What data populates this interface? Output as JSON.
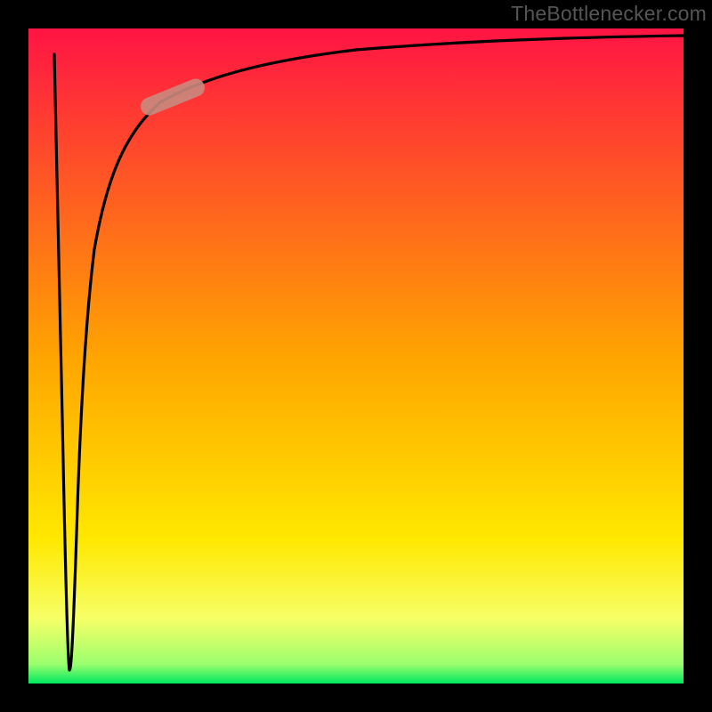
{
  "attribution": {
    "text": "TheBottlenecker.com"
  },
  "chart_data": {
    "type": "line",
    "title": "",
    "xlabel": "",
    "ylabel": "",
    "x_range": [
      0,
      100
    ],
    "y_range": [
      0,
      100
    ],
    "series": [
      {
        "name": "gradient-background",
        "kind": "area-gradient",
        "stops": [
          {
            "pos": 0.0,
            "color": "#ff1444"
          },
          {
            "pos": 0.5,
            "color": "#ffa400"
          },
          {
            "pos": 0.78,
            "color": "#ffe800"
          },
          {
            "pos": 0.9,
            "color": "#f7ff66"
          },
          {
            "pos": 0.97,
            "color": "#9cff6e"
          },
          {
            "pos": 1.0,
            "color": "#00e860"
          }
        ]
      },
      {
        "name": "bottleneck-curve",
        "kind": "curve",
        "notes": "Curve starts near top-left at x≈4 then falls almost vertically to bottom (y≈0) at x≈6, then rises sharply approaching y≈98 asymptotically as x→100.",
        "points": [
          {
            "x": 4.0,
            "y": 96.0
          },
          {
            "x": 4.5,
            "y": 70.0
          },
          {
            "x": 5.0,
            "y": 40.0
          },
          {
            "x": 5.5,
            "y": 15.0
          },
          {
            "x": 6.0,
            "y": 2.0
          },
          {
            "x": 6.3,
            "y": 2.0
          },
          {
            "x": 7.0,
            "y": 30.0
          },
          {
            "x": 8.0,
            "y": 55.0
          },
          {
            "x": 10.0,
            "y": 72.0
          },
          {
            "x": 14.0,
            "y": 83.0
          },
          {
            "x": 20.0,
            "y": 89.0
          },
          {
            "x": 30.0,
            "y": 93.0
          },
          {
            "x": 45.0,
            "y": 95.5
          },
          {
            "x": 65.0,
            "y": 97.0
          },
          {
            "x": 100.0,
            "y": 98.0
          }
        ]
      },
      {
        "name": "highlight-segment",
        "kind": "marker-pill",
        "color": "#c98a7d",
        "center": {
          "x": 22.0,
          "y": 89.5
        },
        "approx_length": 10,
        "approx_angle_deg": 22
      }
    ],
    "frame": {
      "color": "#000000",
      "thickness_px": 32
    }
  }
}
